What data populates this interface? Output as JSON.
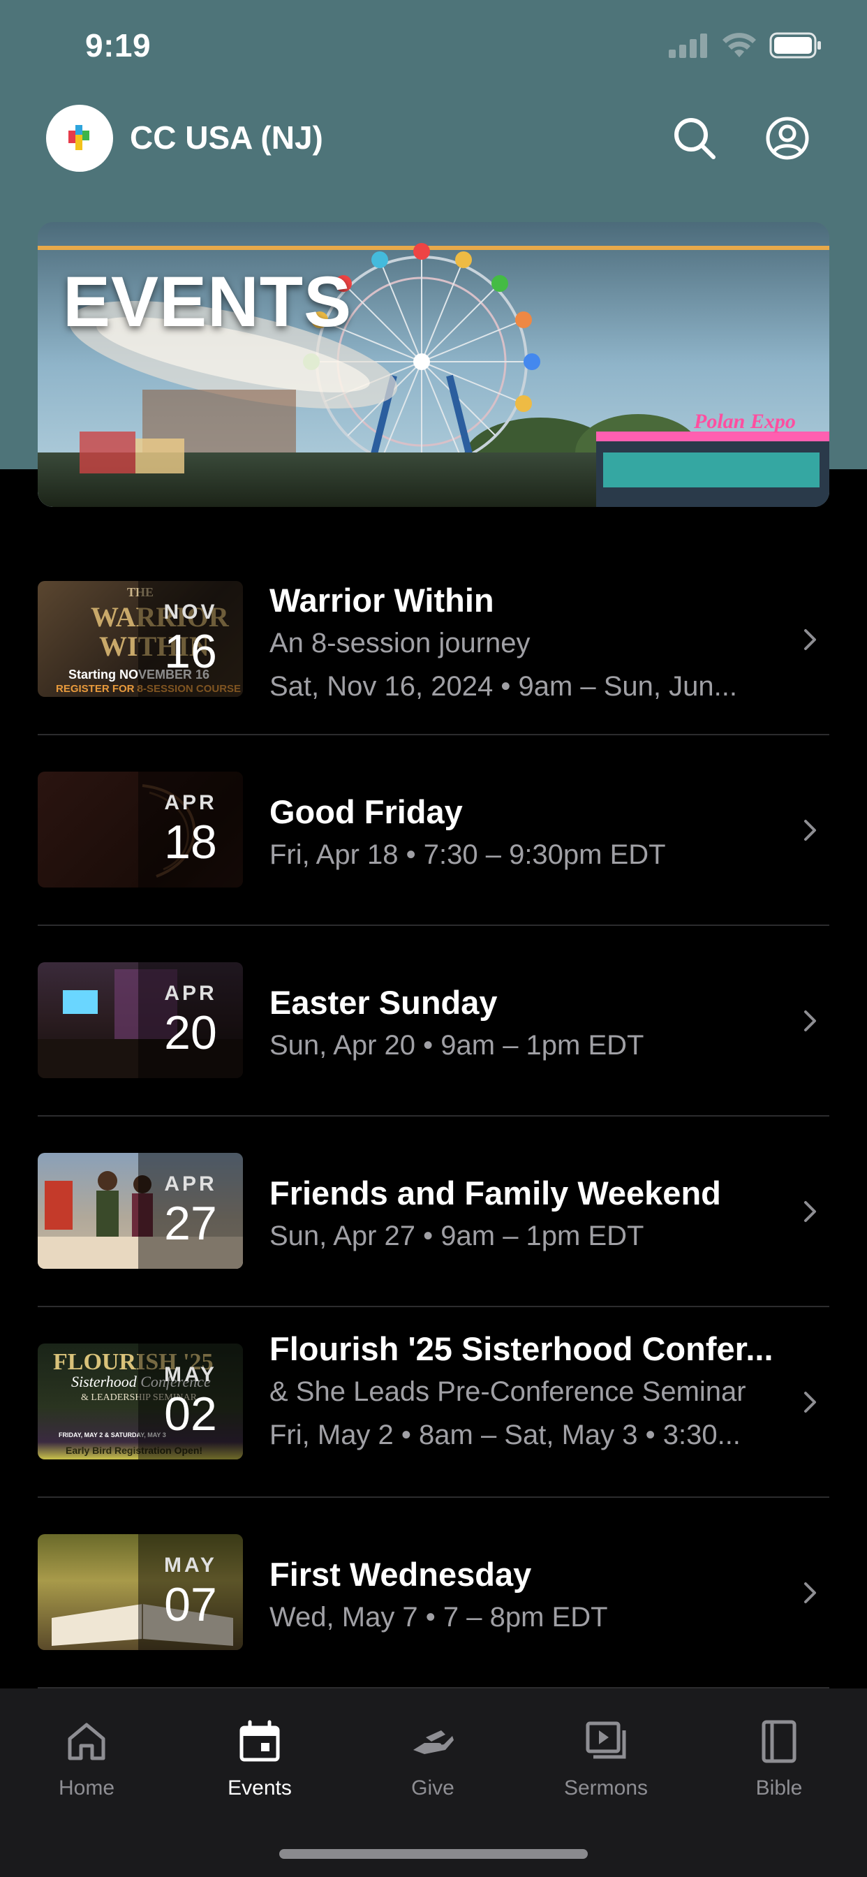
{
  "status_bar": {
    "time": "9:19"
  },
  "header": {
    "org_name": "CC USA (NJ)"
  },
  "banner": {
    "title": "EVENTS",
    "sign_text": "Polan Expo"
  },
  "events": [
    {
      "month": "NOV",
      "day": "16",
      "title": "Warrior Within",
      "lines": [
        "An 8-session journey",
        "Sat, Nov 16, 2024 • 9am – Sun, Jun..."
      ],
      "thumb_text": [
        "THE",
        "WARRIOR",
        "WITHIN",
        "Starting NOVEMBER 16",
        "REGISTER FOR 8-SESSION COURSE"
      ]
    },
    {
      "month": "APR",
      "day": "18",
      "title": "Good Friday",
      "lines": [
        "Fri, Apr 18 • 7:30 – 9:30pm EDT"
      ],
      "thumb_text": []
    },
    {
      "month": "APR",
      "day": "20",
      "title": "Easter Sunday",
      "lines": [
        "Sun, Apr 20 • 9am – 1pm EDT"
      ],
      "thumb_text": []
    },
    {
      "month": "APR",
      "day": "27",
      "title": "Friends and Family Weekend",
      "lines": [
        "Sun, Apr 27 • 9am – 1pm EDT"
      ],
      "thumb_text": []
    },
    {
      "month": "MAY",
      "day": "02",
      "title": "Flourish '25 Sisterhood Confer...",
      "lines": [
        "& She Leads Pre-Conference Seminar",
        "Fri, May 2 • 8am – Sat, May 3 • 3:30..."
      ],
      "thumb_text": [
        "FLOURISH '25",
        "Sisterhood Conference",
        "& LEADERSHIP SEMINAR",
        "FRIDAY, MAY 2 & SATURDAY, MAY 3",
        "Early Bird Registration Open!"
      ]
    },
    {
      "month": "MAY",
      "day": "07",
      "title": "First Wednesday",
      "lines": [
        "Wed, May 7 • 7 – 8pm EDT"
      ],
      "thumb_text": []
    }
  ],
  "tabs": [
    {
      "label": "Home",
      "icon": "home-icon",
      "active": false
    },
    {
      "label": "Events",
      "icon": "calendar-icon",
      "active": true
    },
    {
      "label": "Give",
      "icon": "give-icon",
      "active": false
    },
    {
      "label": "Sermons",
      "icon": "sermons-icon",
      "active": false
    },
    {
      "label": "Bible",
      "icon": "bible-icon",
      "active": false
    }
  ],
  "colors": {
    "header_bg": "#4e7479",
    "background": "#000000",
    "secondary_text": "#a0a0a5",
    "divider": "#2c2c2e",
    "banner_stripe": "#e8a94a"
  }
}
